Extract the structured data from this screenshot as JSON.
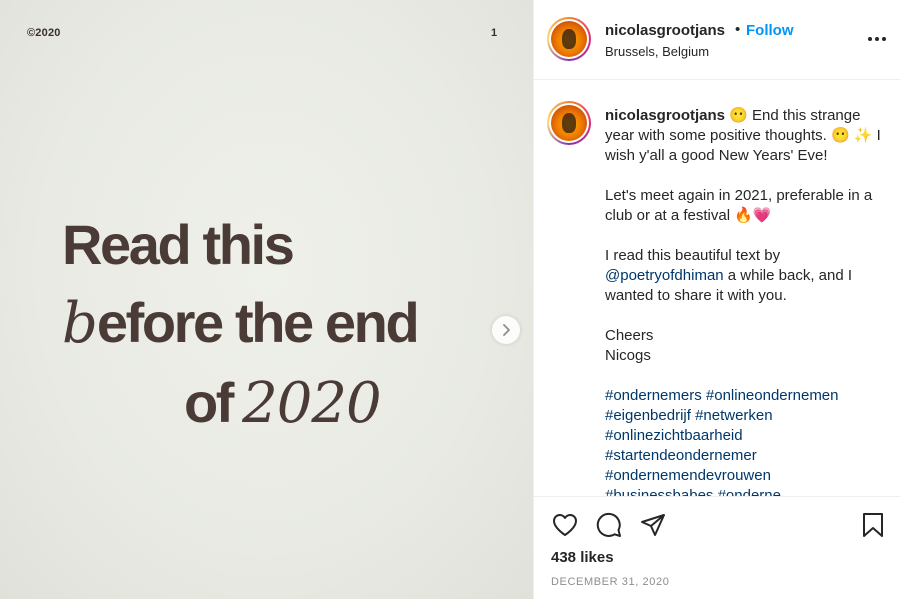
{
  "image": {
    "corner_left": "©2020",
    "corner_right": "1",
    "line1": "Read this",
    "line2_first": "b",
    "line2_rest": "efore the end",
    "line3_of": "of",
    "line3_year": "2020"
  },
  "post": {
    "username": "nicolasgrootjans",
    "dot": "•",
    "follow_label": "Follow",
    "location": "Brussels, Belgium"
  },
  "caption": {
    "username": "nicolasgrootjans",
    "line1": "😶 End this strange year with some positive thoughts. 😶 ✨ I wish y'all a good New Years' Eve!",
    "line2": "Let's meet again in 2021, preferable in a club or at a festival 🔥💗",
    "line3_a": "I read this beautiful text by",
    "line3_mention": "@poetryofdhiman",
    "line3_b": " a while back, and I wanted to share it with you.",
    "line4a": "Cheers",
    "line4b": "Nicogs",
    "hashtags": [
      "#ondernemers #onlineondernemen",
      "#eigenbedrijf #netwerken",
      "#onlinezichtbaarheid",
      "#startendeondernemer",
      "#ondernemendevrouwen",
      "#businessbabes #onderne"
    ]
  },
  "actions": {
    "icons": [
      "heart-icon",
      "comment-icon",
      "share-icon",
      "bookmark-icon"
    ]
  },
  "likes": "438 likes",
  "date": "DECEMBER 31, 2020"
}
